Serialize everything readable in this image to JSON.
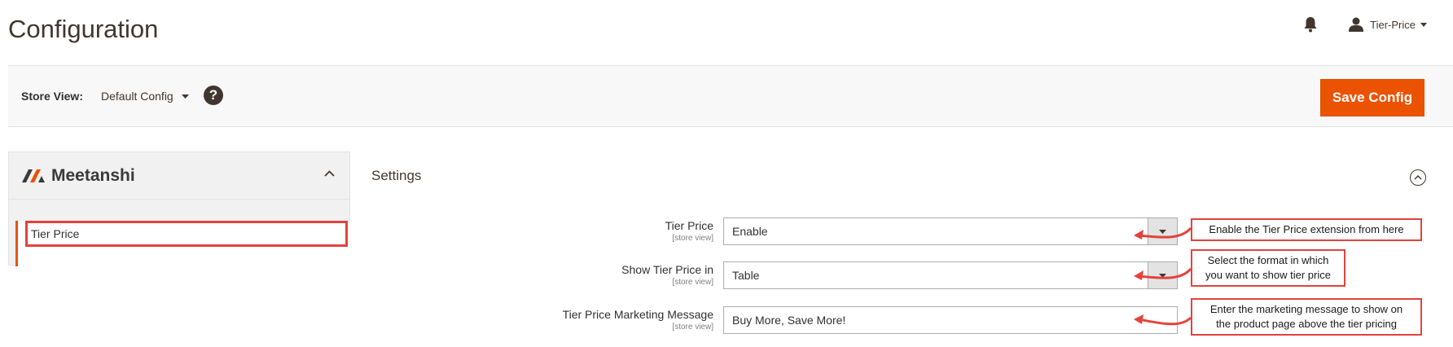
{
  "page": {
    "title": "Configuration"
  },
  "header": {
    "user_name": "Tier-Price",
    "icons": [
      "bell-icon",
      "user-icon",
      "chevron-down-icon"
    ]
  },
  "store_bar": {
    "label": "Store View:",
    "selected": "Default Config",
    "help": "?",
    "save_label": "Save Config"
  },
  "colors": {
    "accent": "#eb5202",
    "annotation": "#e2433c",
    "text": "#41362f"
  },
  "sidebar": {
    "brand": "Meetanshi",
    "items": [
      {
        "label": "Tier Price"
      }
    ]
  },
  "settings": {
    "title": "Settings",
    "rows": [
      {
        "label": "Tier Price",
        "scope": "[store view]",
        "value": "Enable",
        "type": "select"
      },
      {
        "label": "Show Tier Price in",
        "scope": "[store view]",
        "value": "Table",
        "type": "select"
      },
      {
        "label": "Tier Price Marketing Message",
        "scope": "[store view]",
        "value": "Buy More, Save More!",
        "type": "text"
      }
    ]
  },
  "annotations": [
    {
      "line1": "Enable the Tier Price extension from here",
      "line2": ""
    },
    {
      "line1": "Select the format in which",
      "line2": "you want to show tier price"
    },
    {
      "line1": "Enter the marketing message to show on",
      "line2": "the product page above the tier pricing"
    }
  ]
}
